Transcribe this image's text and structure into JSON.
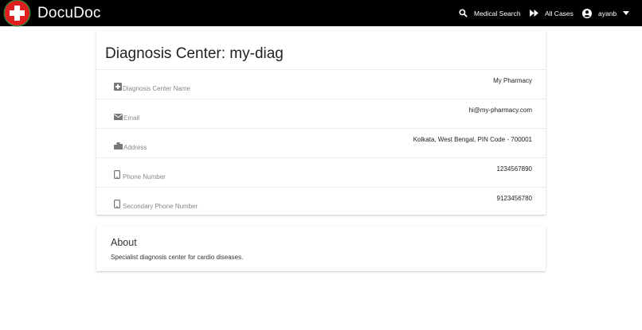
{
  "header": {
    "brand": "DocuDoc",
    "search_label": "Medical Search",
    "cases_label": "All Cases",
    "username": "ayanb"
  },
  "page": {
    "title": "Diagnosis Center: my-diag"
  },
  "details": [
    {
      "icon": "plus-box-icon",
      "label": "Diagnosis Center Name",
      "value": "My Pharmacy"
    },
    {
      "icon": "email-icon",
      "label": "Email",
      "value": "hi@my-pharmacy.com"
    },
    {
      "icon": "building-icon",
      "label": "Address",
      "value": "Kolkata, West Bengal, PIN Code - 700001"
    },
    {
      "icon": "phone-icon",
      "label": "Phone Number",
      "value": "1234567890"
    },
    {
      "icon": "phone-icon",
      "label": "Secondary Phone Number",
      "value": "9123456780"
    }
  ],
  "about": {
    "title": "About",
    "text": "Specialist diagnosis center for cardio diseases."
  }
}
